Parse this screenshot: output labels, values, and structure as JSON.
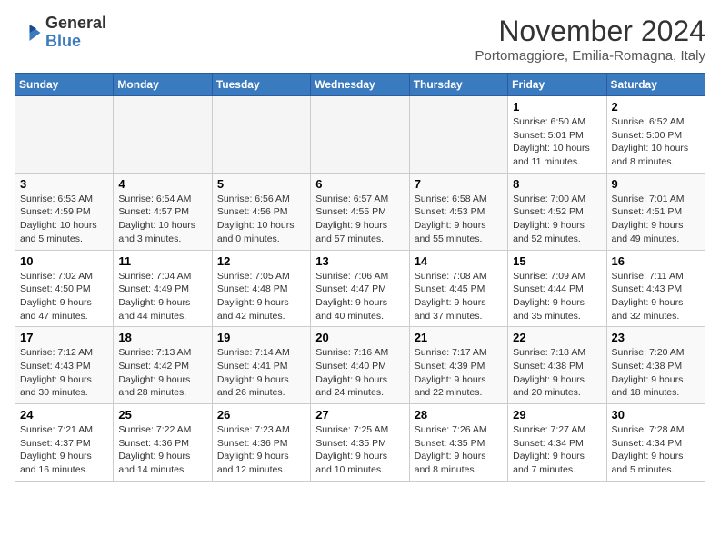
{
  "header": {
    "logo": {
      "general": "General",
      "blue": "Blue"
    },
    "month": "November 2024",
    "location": "Portomaggiore, Emilia-Romagna, Italy"
  },
  "days_of_week": [
    "Sunday",
    "Monday",
    "Tuesday",
    "Wednesday",
    "Thursday",
    "Friday",
    "Saturday"
  ],
  "weeks": [
    {
      "cells": [
        {
          "day": null,
          "info": null
        },
        {
          "day": null,
          "info": null
        },
        {
          "day": null,
          "info": null
        },
        {
          "day": null,
          "info": null
        },
        {
          "day": null,
          "info": null
        },
        {
          "day": "1",
          "info": "Sunrise: 6:50 AM\nSunset: 5:01 PM\nDaylight: 10 hours and 11 minutes."
        },
        {
          "day": "2",
          "info": "Sunrise: 6:52 AM\nSunset: 5:00 PM\nDaylight: 10 hours and 8 minutes."
        }
      ]
    },
    {
      "cells": [
        {
          "day": "3",
          "info": "Sunrise: 6:53 AM\nSunset: 4:59 PM\nDaylight: 10 hours and 5 minutes."
        },
        {
          "day": "4",
          "info": "Sunrise: 6:54 AM\nSunset: 4:57 PM\nDaylight: 10 hours and 3 minutes."
        },
        {
          "day": "5",
          "info": "Sunrise: 6:56 AM\nSunset: 4:56 PM\nDaylight: 10 hours and 0 minutes."
        },
        {
          "day": "6",
          "info": "Sunrise: 6:57 AM\nSunset: 4:55 PM\nDaylight: 9 hours and 57 minutes."
        },
        {
          "day": "7",
          "info": "Sunrise: 6:58 AM\nSunset: 4:53 PM\nDaylight: 9 hours and 55 minutes."
        },
        {
          "day": "8",
          "info": "Sunrise: 7:00 AM\nSunset: 4:52 PM\nDaylight: 9 hours and 52 minutes."
        },
        {
          "day": "9",
          "info": "Sunrise: 7:01 AM\nSunset: 4:51 PM\nDaylight: 9 hours and 49 minutes."
        }
      ]
    },
    {
      "cells": [
        {
          "day": "10",
          "info": "Sunrise: 7:02 AM\nSunset: 4:50 PM\nDaylight: 9 hours and 47 minutes."
        },
        {
          "day": "11",
          "info": "Sunrise: 7:04 AM\nSunset: 4:49 PM\nDaylight: 9 hours and 44 minutes."
        },
        {
          "day": "12",
          "info": "Sunrise: 7:05 AM\nSunset: 4:48 PM\nDaylight: 9 hours and 42 minutes."
        },
        {
          "day": "13",
          "info": "Sunrise: 7:06 AM\nSunset: 4:47 PM\nDaylight: 9 hours and 40 minutes."
        },
        {
          "day": "14",
          "info": "Sunrise: 7:08 AM\nSunset: 4:45 PM\nDaylight: 9 hours and 37 minutes."
        },
        {
          "day": "15",
          "info": "Sunrise: 7:09 AM\nSunset: 4:44 PM\nDaylight: 9 hours and 35 minutes."
        },
        {
          "day": "16",
          "info": "Sunrise: 7:11 AM\nSunset: 4:43 PM\nDaylight: 9 hours and 32 minutes."
        }
      ]
    },
    {
      "cells": [
        {
          "day": "17",
          "info": "Sunrise: 7:12 AM\nSunset: 4:43 PM\nDaylight: 9 hours and 30 minutes."
        },
        {
          "day": "18",
          "info": "Sunrise: 7:13 AM\nSunset: 4:42 PM\nDaylight: 9 hours and 28 minutes."
        },
        {
          "day": "19",
          "info": "Sunrise: 7:14 AM\nSunset: 4:41 PM\nDaylight: 9 hours and 26 minutes."
        },
        {
          "day": "20",
          "info": "Sunrise: 7:16 AM\nSunset: 4:40 PM\nDaylight: 9 hours and 24 minutes."
        },
        {
          "day": "21",
          "info": "Sunrise: 7:17 AM\nSunset: 4:39 PM\nDaylight: 9 hours and 22 minutes."
        },
        {
          "day": "22",
          "info": "Sunrise: 7:18 AM\nSunset: 4:38 PM\nDaylight: 9 hours and 20 minutes."
        },
        {
          "day": "23",
          "info": "Sunrise: 7:20 AM\nSunset: 4:38 PM\nDaylight: 9 hours and 18 minutes."
        }
      ]
    },
    {
      "cells": [
        {
          "day": "24",
          "info": "Sunrise: 7:21 AM\nSunset: 4:37 PM\nDaylight: 9 hours and 16 minutes."
        },
        {
          "day": "25",
          "info": "Sunrise: 7:22 AM\nSunset: 4:36 PM\nDaylight: 9 hours and 14 minutes."
        },
        {
          "day": "26",
          "info": "Sunrise: 7:23 AM\nSunset: 4:36 PM\nDaylight: 9 hours and 12 minutes."
        },
        {
          "day": "27",
          "info": "Sunrise: 7:25 AM\nSunset: 4:35 PM\nDaylight: 9 hours and 10 minutes."
        },
        {
          "day": "28",
          "info": "Sunrise: 7:26 AM\nSunset: 4:35 PM\nDaylight: 9 hours and 8 minutes."
        },
        {
          "day": "29",
          "info": "Sunrise: 7:27 AM\nSunset: 4:34 PM\nDaylight: 9 hours and 7 minutes."
        },
        {
          "day": "30",
          "info": "Sunrise: 7:28 AM\nSunset: 4:34 PM\nDaylight: 9 hours and 5 minutes."
        }
      ]
    }
  ]
}
